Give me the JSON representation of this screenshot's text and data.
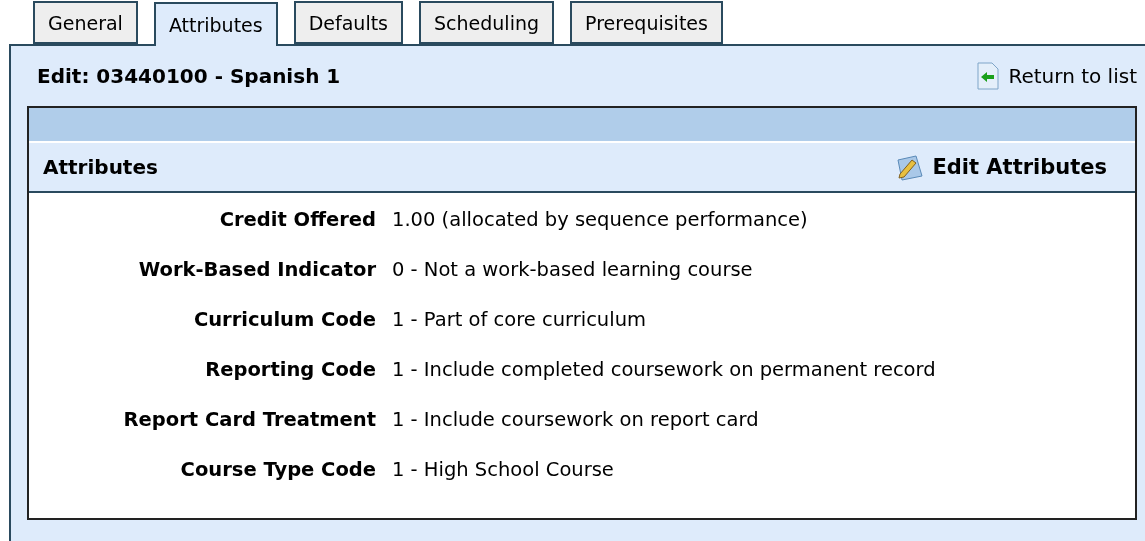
{
  "tabs": [
    {
      "label": "General",
      "selected": false
    },
    {
      "label": "Attributes",
      "selected": true
    },
    {
      "label": "Defaults",
      "selected": false
    },
    {
      "label": "Scheduling",
      "selected": false
    },
    {
      "label": "Prerequisites",
      "selected": false
    }
  ],
  "page_title": "Edit: 03440100 - Spanish 1",
  "return_link": "Return to list",
  "section": {
    "title": "Attributes",
    "edit_button": "Edit Attributes"
  },
  "fields": [
    {
      "label": "Credit Offered",
      "value": "1.00 (allocated by sequence performance)"
    },
    {
      "label": "Work-Based Indicator",
      "value": "0 - Not a work-based learning course"
    },
    {
      "label": "Curriculum Code",
      "value": "1 - Part of core curriculum"
    },
    {
      "label": "Reporting Code",
      "value": "1 - Include completed coursework on permanent record"
    },
    {
      "label": "Report Card Treatment",
      "value": "1 - Include coursework on report card"
    },
    {
      "label": "Course Type Code",
      "value": "1 - High School Course"
    }
  ]
}
